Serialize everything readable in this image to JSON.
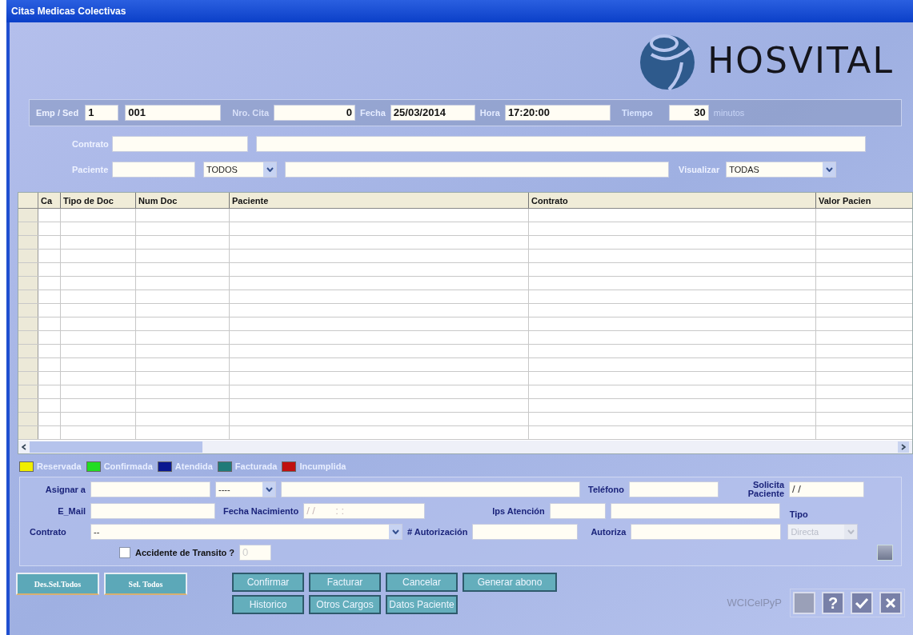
{
  "window": {
    "title": "Citas Medicas Colectivas"
  },
  "logo": {
    "text": "HOSVITAL"
  },
  "header": {
    "emp_sed": {
      "label": "Emp / Sed",
      "empresa": "1",
      "sede": "001"
    },
    "nro_cita": {
      "label": "Nro. Cita",
      "value": "0"
    },
    "fecha": {
      "label": "Fecha",
      "value": "25/03/2014"
    },
    "hora": {
      "label": "Hora",
      "value": "17:20:00"
    },
    "tiempo": {
      "label": "Tiempo",
      "value": "30",
      "unit": "minutos"
    }
  },
  "filters": {
    "contrato": {
      "label": "Contrato"
    },
    "paciente": {
      "label": "Paciente",
      "tipo": "TODOS"
    },
    "visualizar": {
      "label": "Visualizar",
      "value": "TODAS"
    }
  },
  "table": {
    "columns": [
      "Ca",
      "Tipo de Doc",
      "Num Doc",
      "Paciente",
      "Contrato",
      "Valor Pacien"
    ]
  },
  "legend": [
    {
      "label": "Reservada",
      "color": "#f0ee00"
    },
    {
      "label": "Confirmada",
      "color": "#22dd22"
    },
    {
      "label": "Atendida",
      "color": "#0a1890"
    },
    {
      "label": "Facturada",
      "color": "#1f7a78"
    },
    {
      "label": "Incumplida",
      "color": "#c01010"
    }
  ],
  "form": {
    "asignar": {
      "label": "Asignar a",
      "tipo": "----"
    },
    "telefono": {
      "label": "Teléfono"
    },
    "solicita": {
      "label": "Solicita Paciente",
      "value": "/ /"
    },
    "email": {
      "label": "E_Mail"
    },
    "fecha_nacimiento": {
      "label": "Fecha Nacimiento",
      "placeholder": "/ /       : :"
    },
    "ips": {
      "label": "Ips Atención"
    },
    "tipo": {
      "label": "Tipo",
      "value": "Directa",
      "disabled": true
    },
    "contrato": {
      "label": "Contrato",
      "value": "--"
    },
    "autorizacion": {
      "label": "# Autorización"
    },
    "autoriza": {
      "label": "Autoriza"
    },
    "accidente": {
      "label": "Accidente de Transito ?",
      "checked": false,
      "placeholder": "0"
    }
  },
  "selection_buttons": [
    "Des.Sel.Todos",
    "Sel. Todos"
  ],
  "actions": [
    [
      "Confirmar",
      "Facturar",
      "Cancelar",
      "Generar abono"
    ],
    [
      "Historico",
      "Otros Cargos",
      "Datos Paciente"
    ]
  ],
  "form_name": "WCICelPyP",
  "toolbar": [
    {
      "kind": "blank",
      "disabled": true
    },
    {
      "kind": "help",
      "text": "?",
      "disabled": false
    },
    {
      "kind": "accept",
      "disabled": false
    },
    {
      "kind": "close",
      "disabled": false
    }
  ]
}
